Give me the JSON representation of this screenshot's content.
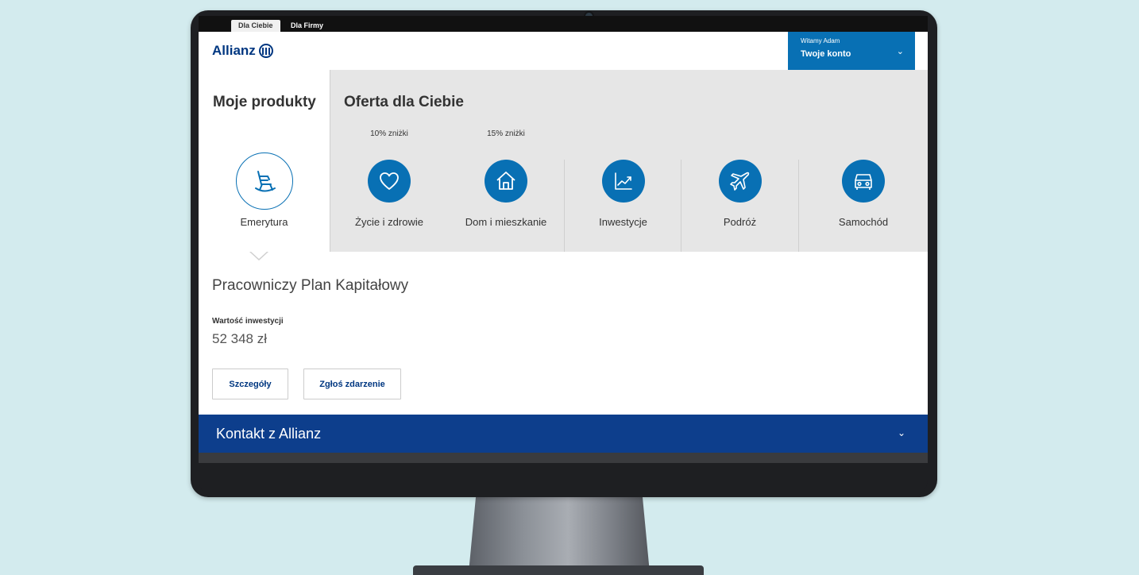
{
  "tabs": [
    {
      "label": "Dla Ciebie",
      "active": true
    },
    {
      "label": "Dla Firmy",
      "active": false
    }
  ],
  "brand": {
    "name": "Allianz",
    "color": "#003781"
  },
  "account": {
    "greeting": "Witamy Adam",
    "label": "Twoje konto",
    "color": "#0870b4"
  },
  "my_products": {
    "title": "Moje produkty",
    "items": [
      {
        "name": "Emerytura",
        "icon": "rocking-chair-icon"
      }
    ]
  },
  "offer": {
    "title": "Oferta dla Ciebie",
    "items": [
      {
        "name": "Życie i zdrowie",
        "discount": "10% zniżki",
        "icon": "heart-icon"
      },
      {
        "name": "Dom i mieszkanie",
        "discount": "15% zniżki",
        "icon": "house-icon"
      },
      {
        "name": "Inwestycje",
        "discount": "",
        "icon": "chart-icon"
      },
      {
        "name": "Podróż",
        "discount": "",
        "icon": "airplane-icon"
      },
      {
        "name": "Samochód",
        "discount": "",
        "icon": "car-icon"
      }
    ]
  },
  "detail": {
    "title": "Pracowniczy Plan Kapitałowy",
    "value_label": "Wartość inwestycji",
    "value": "52 348 zł",
    "buttons": {
      "details": "Szczegóły",
      "report": "Zgłoś zdarzenie"
    }
  },
  "contact": {
    "label": "Kontakt z Allianz",
    "color": "#0d3e8c"
  }
}
